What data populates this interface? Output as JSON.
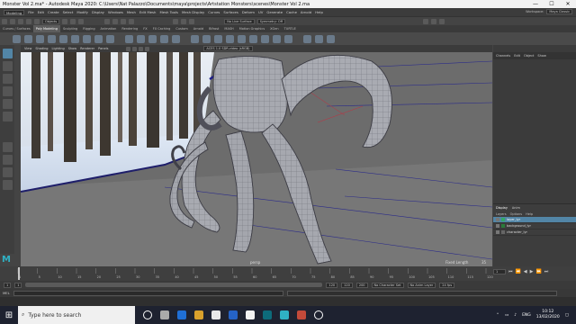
{
  "window": {
    "title": "Monster Vol 2.ma* - Autodesk Maya 2020: C:\\Users\\Nat Palazzo\\Documents\\maya\\projects\\Artstation Monsters\\scenes\\Monster Vol 2.ma",
    "minimize": "—",
    "maximize": "☐",
    "close": "✕"
  },
  "menubar": {
    "items": [
      "Modeling",
      "File",
      "Edit",
      "Create",
      "Select",
      "Modify",
      "Display",
      "Windows",
      "Mesh",
      "Edit Mesh",
      "Mesh Tools",
      "Mesh Display",
      "Curves",
      "Surfaces",
      "Deform",
      "UV",
      "Generate",
      "Cache",
      "Arnold",
      "Help"
    ],
    "workspace_label": "Workspace:",
    "workspace_value": "Maya Classic"
  },
  "statusline": {
    "objects_label": "Objects",
    "live_surface": "No Live Surface",
    "symmetry": "Symmetry: Off"
  },
  "shelf": {
    "tabs": [
      "Curves / Surfaces",
      "Poly Modeling",
      "Sculpting",
      "Rigging",
      "Animation",
      "Rendering",
      "FX",
      "FX Caching",
      "Custom",
      "Arnold",
      "Bifrost",
      "MASH",
      "Motion Graphics",
      "XGen",
      "TURTLE"
    ],
    "active_tab": 1
  },
  "viewport": {
    "menu": [
      "View",
      "Shading",
      "Lighting",
      "Show",
      "Renderer",
      "Panels"
    ],
    "camera_label": "persp",
    "focal_label": "Fixed Length",
    "focal_value": "35",
    "colorspace": "ACES 1.0 SDR-video (sRGB)",
    "grid_colors": {
      "line": "#2b2b8a",
      "ref": "#c03040"
    }
  },
  "channel_box": {
    "menu": [
      "Channels",
      "Edit",
      "Object",
      "Show"
    ]
  },
  "layers": {
    "tabs": [
      "Display",
      "Anim"
    ],
    "menu": [
      "Layers",
      "Options",
      "Help"
    ],
    "rows": [
      {
        "name": "layer_lyr",
        "selected": true
      },
      {
        "name": "background_lyr",
        "selected": false
      },
      {
        "name": "character_lyr",
        "selected": false
      }
    ]
  },
  "timeline": {
    "ticks": [
      "1",
      "5",
      "10",
      "15",
      "20",
      "25",
      "30",
      "35",
      "40",
      "45",
      "50",
      "55",
      "60",
      "65",
      "70",
      "75",
      "80",
      "85",
      "90",
      "95",
      "100",
      "105",
      "110",
      "115",
      "120"
    ],
    "current_frame": "1"
  },
  "range": {
    "start": "1",
    "start2": "1",
    "end": "120",
    "end2": "120",
    "end3": "200",
    "character_set": "No Character Set",
    "anim_layer": "No Anim Layer",
    "fps": "24 fps"
  },
  "cmdline": {
    "label": "MEL"
  },
  "taskbar": {
    "search_placeholder": "Type here to search",
    "language": "ENG",
    "time": "10:12",
    "date": "13/02/2020"
  }
}
